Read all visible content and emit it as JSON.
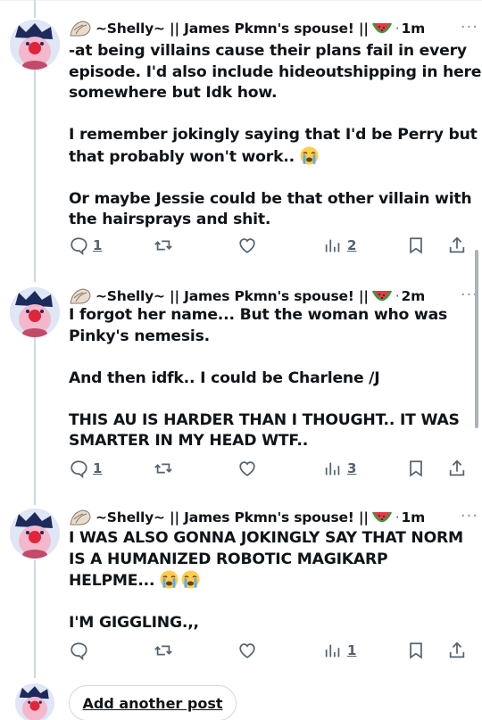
{
  "posts": [
    {
      "author": "~Shelly~ || James Pkmn's spouse! ||",
      "separator": "·",
      "time": "1m",
      "lines": [
        "-at being villains cause their plans fail in every",
        "episode. I'd also include hideoutshipping in here",
        "somewhere but Idk how.",
        "",
        "I remember jokingly saying that I'd be Perry but",
        "that probably won't work..",
        "",
        "Or maybe Jessie could be that other villain with",
        "the hairsprays and shit."
      ],
      "replies": "1",
      "views": "2"
    },
    {
      "author": "~Shelly~ || James Pkmn's spouse! ||",
      "separator": "·",
      "time": "2m",
      "lines": [
        "I forgot her name... But the woman who was",
        "Pinky's nemesis.",
        "",
        "And then idfk.. I could be Charlene /J",
        "",
        "THIS AU IS HARDER THAN I THOUGHT.. IT WAS",
        "SMARTER IN MY HEAD WTF.."
      ],
      "replies": "1",
      "views": "3"
    },
    {
      "author": "~Shelly~ || James Pkmn's spouse! ||",
      "separator": "·",
      "time": "1m",
      "lines": [
        "I WAS ALSO GONNA JOKINGLY SAY THAT NORM",
        "IS A HUMANIZED ROBOTIC MAGIKARP",
        "HELPME...",
        "",
        "I'M GIGGLING.,,"
      ],
      "replies": "",
      "views": "1"
    }
  ],
  "add_post_label": "Add another post",
  "icons": {
    "reply": "reply-icon",
    "repost": "repost-icon",
    "like": "heart-icon",
    "views": "views-chart-icon",
    "bookmark": "bookmark-icon",
    "share": "share-icon",
    "more": "more-dots-icon",
    "shell": "shell-emoji",
    "watermelon": "watermelon-emoji",
    "crying": "loudly-crying-emoji"
  },
  "colors": {
    "text": "#0f1419",
    "muted": "#536471",
    "rail": "#cfd9de",
    "avatar_pink": "#f3b8cc"
  }
}
